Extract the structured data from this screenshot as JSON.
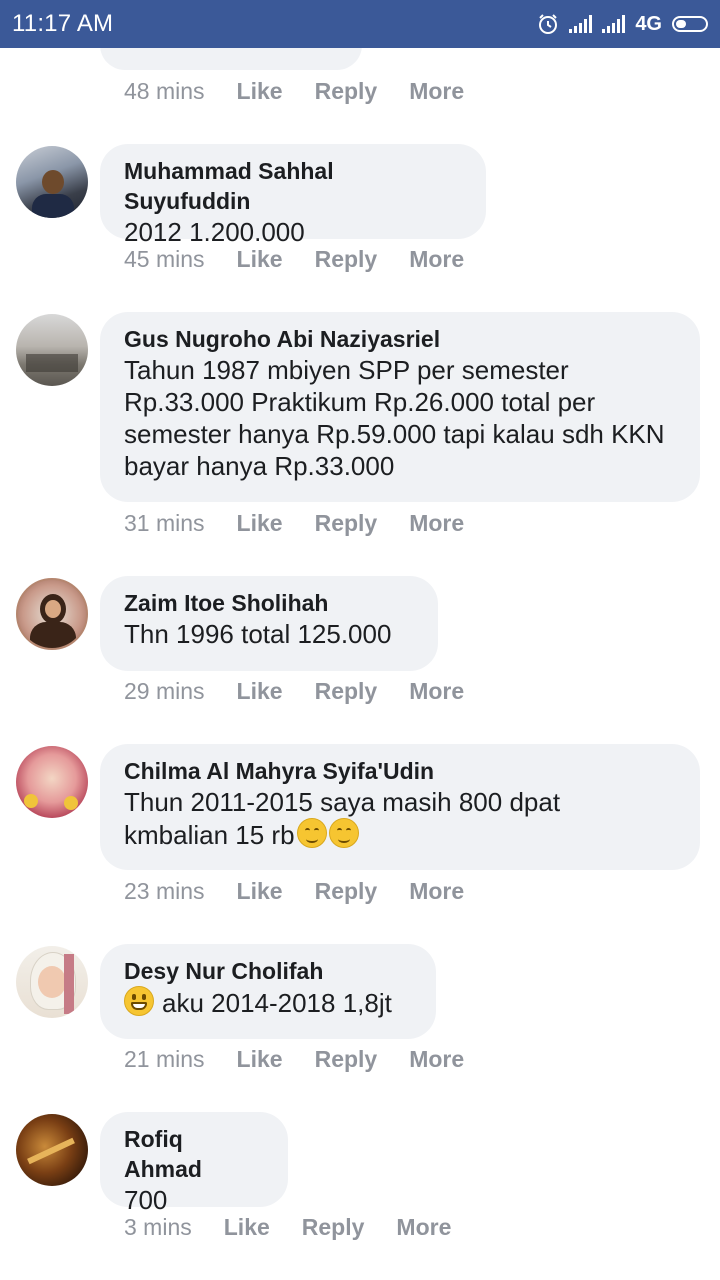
{
  "status_bar": {
    "time": "11:17 AM",
    "network": "4G",
    "icons": [
      "alarm-icon",
      "signal-icon",
      "signal-icon",
      "battery-icon"
    ]
  },
  "actions": {
    "like": "Like",
    "reply": "Reply",
    "more": "More"
  },
  "comments": [
    {
      "time": "48 mins"
    },
    {
      "name": "Muhammad Sahhal Suyufuddin",
      "text": "2012 1.200.000",
      "time": "45 mins"
    },
    {
      "name": "Gus Nugroho Abi Naziyasriel",
      "text": "Tahun 1987 mbiyen SPP per semester Rp.33.000 Praktikum Rp.26.000 total per semester hanya Rp.59.000 tapi kalau sdh KKN bayar hanya Rp.33.000",
      "time": "31 mins"
    },
    {
      "name": "Zaim Itoe Sholihah",
      "text": "Thn 1996 total 125.000",
      "time": "29 mins"
    },
    {
      "name": "Chilma Al Mahyra Syifa'Udin",
      "text_line1": "Thun 2011-2015 saya masih 800 dpat",
      "text_line2": "kmbalian 15 rb",
      "time": "23 mins"
    },
    {
      "name": "Desy Nur Cholifah",
      "text": "aku 2014-2018 1,8jt",
      "time": "21 mins"
    },
    {
      "name": "Rofiq Ahmad",
      "text": "700",
      "time": "3 mins"
    }
  ],
  "colors": {
    "status_bar": "#3b5998",
    "bubble": "#f0f2f5",
    "meta_text": "#90949c",
    "name_text": "#1c1e21"
  }
}
